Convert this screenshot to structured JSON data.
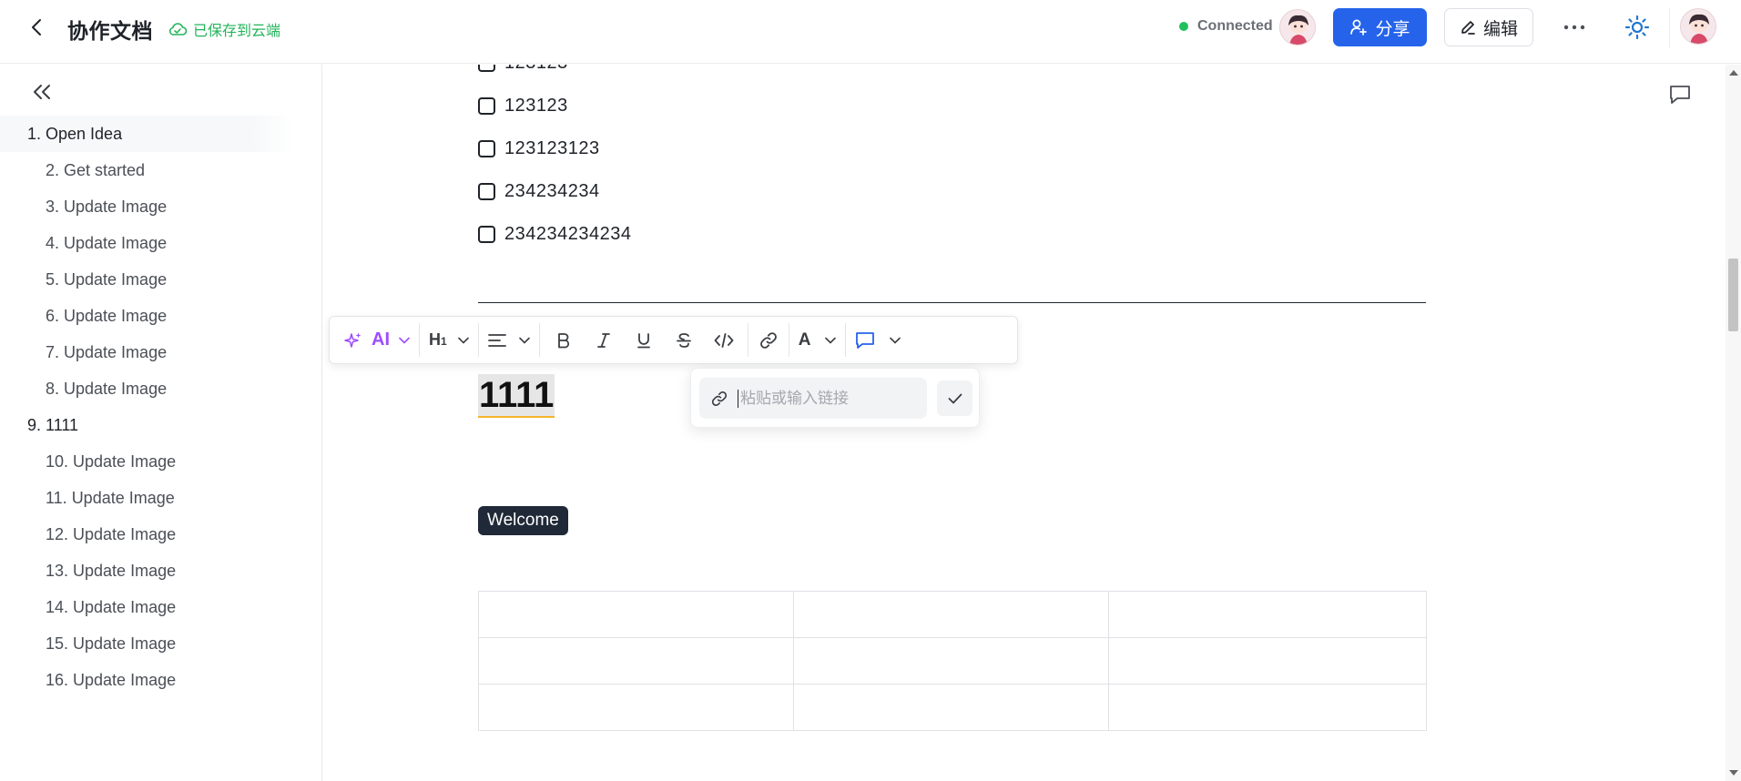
{
  "header": {
    "title": "协作文档",
    "save_status": "已保存到云端",
    "connection": "Connected",
    "share_label": "分享",
    "edit_label": "编辑",
    "status_color": "#20c05c",
    "accent_color": "#2563eb"
  },
  "toc": {
    "items": [
      {
        "label": "1. Open Idea",
        "level": 1,
        "active": true
      },
      {
        "label": "2. Get started",
        "level": 2
      },
      {
        "label": "3. Update Image",
        "level": 2
      },
      {
        "label": "4. Update Image",
        "level": 2
      },
      {
        "label": "5. Update Image",
        "level": 2
      },
      {
        "label": "6. Update Image",
        "level": 2
      },
      {
        "label": "7. Update Image",
        "level": 2
      },
      {
        "label": "8. Update Image",
        "level": 2
      },
      {
        "label": "9. 1111",
        "level": 1
      },
      {
        "label": "10. Update Image",
        "level": 2
      },
      {
        "label": "11. Update Image",
        "level": 2
      },
      {
        "label": "12. Update Image",
        "level": 2
      },
      {
        "label": "13. Update Image",
        "level": 2
      },
      {
        "label": "14. Update Image",
        "level": 2
      },
      {
        "label": "15. Update Image",
        "level": 2
      },
      {
        "label": "16. Update Image",
        "level": 2
      }
    ]
  },
  "editor": {
    "tasks": [
      "123123",
      "123123",
      "123123123",
      "234234234",
      "234234234234"
    ],
    "heading": "1111",
    "tag": "Welcome",
    "table": {
      "rows": 3,
      "cols": 3
    }
  },
  "toolbar": {
    "ai_label": "AI",
    "heading_label": "H",
    "heading_sub": "1",
    "color_label": "A",
    "ai_color": "#9d4dff"
  },
  "link_popover": {
    "placeholder": "粘贴或输入链接"
  }
}
